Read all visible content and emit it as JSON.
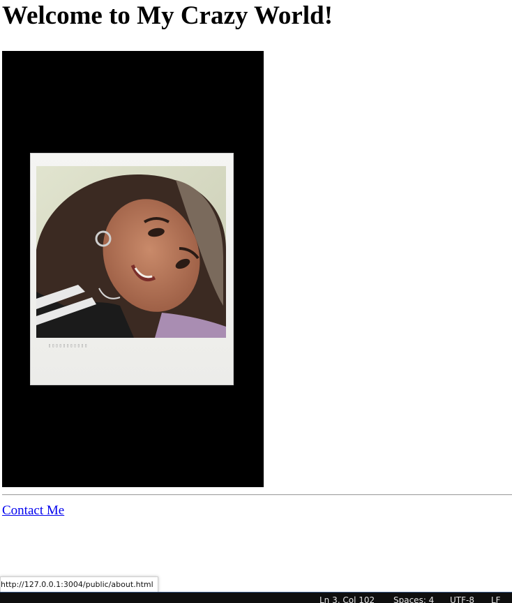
{
  "page": {
    "title": "Welcome to My Crazy World!",
    "contact_link": "Contact Me"
  },
  "photo": {
    "description_alt": "Polaroid photo"
  },
  "browser_status": {
    "hover_url": "http://127.0.0.1:3004/public/about.html"
  },
  "editor_status_bar": {
    "cursor_position": "Ln 3, Col 102",
    "indentation": "Spaces: 4",
    "encoding": "UTF-8",
    "line_ending": "LF"
  },
  "colors": {
    "link": "#0000ee",
    "photo_background": "#000000",
    "status_bar_background": "#0f0f0f"
  }
}
